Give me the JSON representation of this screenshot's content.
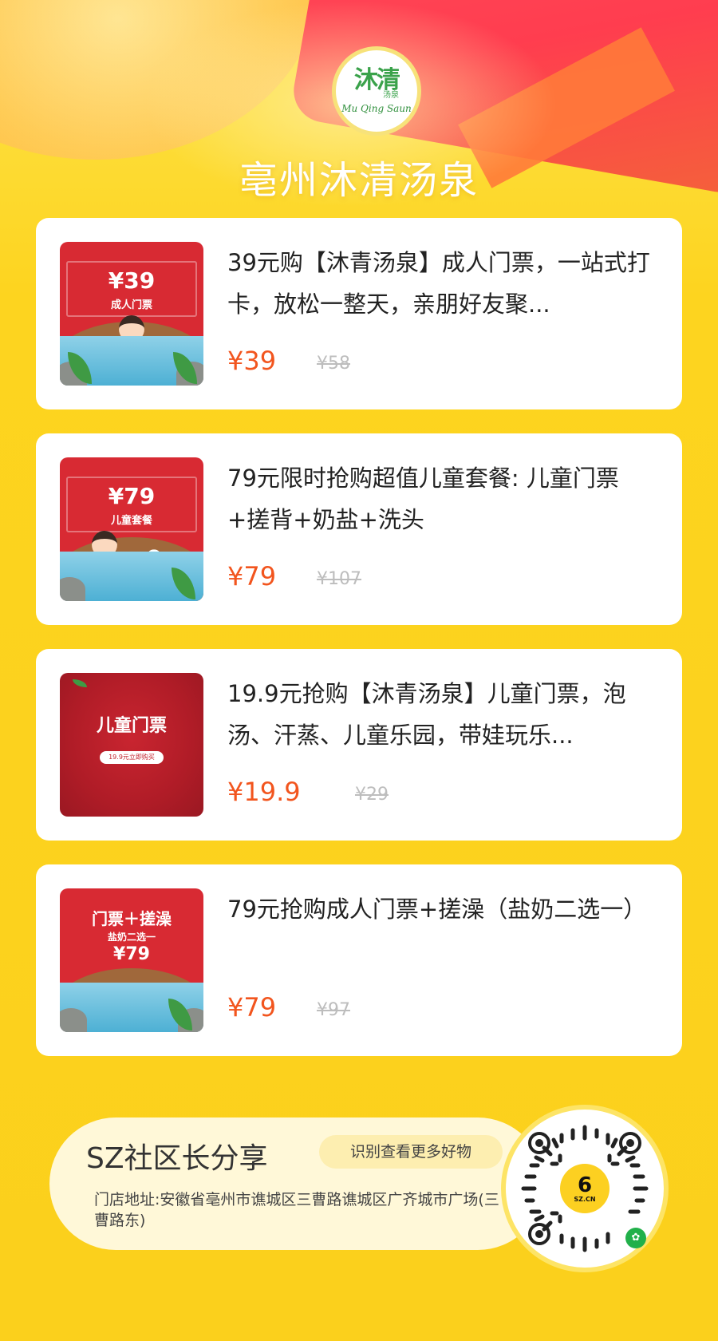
{
  "header": {
    "logo_cn": "沐清",
    "logo_sub": "汤泉",
    "logo_en": "Mu Qing Saun",
    "store_title": "亳州沐清汤泉"
  },
  "products": [
    {
      "thumb_price": "¥39",
      "thumb_label": "成人门票",
      "title": "39元购【沐青汤泉】成人门票，一站式打卡，放松一整天，亲朋好友聚...",
      "price": "¥39",
      "original_price": "¥58"
    },
    {
      "thumb_price": "¥79",
      "thumb_label": "儿童套餐",
      "title": "79元限时抢购超值儿童套餐: 儿童门票+搓背+奶盐+洗头",
      "price": "¥79",
      "original_price": "¥107"
    },
    {
      "thumb_title": "儿童门票",
      "thumb_pill": "19.9元立即购买",
      "title": "19.9元抢购【沐青汤泉】儿童门票，泡汤、汗蒸、儿童乐园，带娃玩乐...",
      "price": "¥19.9",
      "original_price": "¥29"
    },
    {
      "thumb_title": "门票＋搓澡",
      "thumb_sub": "盐奶二选一",
      "thumb_price": "¥79",
      "title": "79元抢购成人门票+搓澡（盐奶二选一）",
      "price": "¥79",
      "original_price": "¥97"
    }
  ],
  "footer": {
    "brand": "SZ社区长分享",
    "tag": "识别查看更多好物",
    "address": "门店地址:安徽省亳州市谯城区三曹路谯城区广齐城市广场(三曹路东)",
    "qr_logo": "6",
    "qr_domain": "SZ.CN"
  },
  "colors": {
    "background": "#fbd21e",
    "price_accent": "#f2551e",
    "thumb_red": "#d82a33",
    "brand_green": "#3aa24a"
  }
}
